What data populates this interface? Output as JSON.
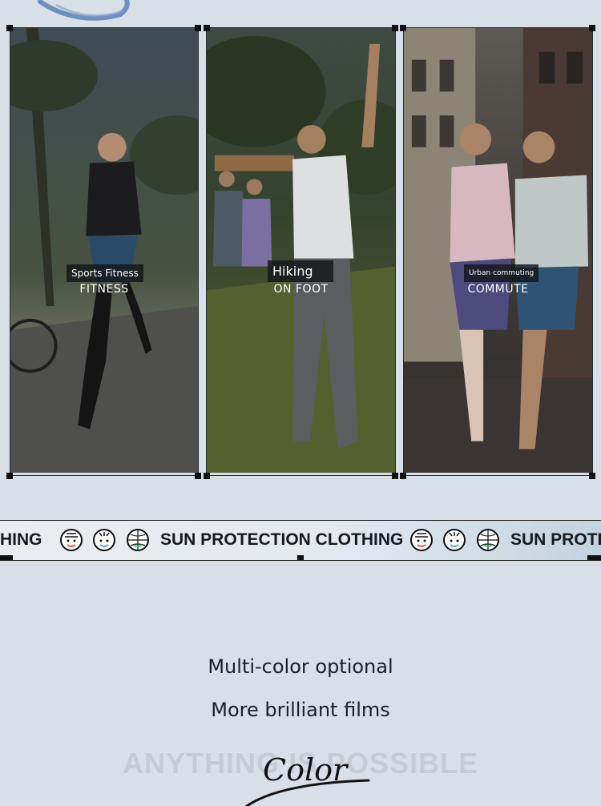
{
  "panels": [
    {
      "tag": "Sports Fitness",
      "sub": "FITNESS"
    },
    {
      "tag": "Hiking",
      "sub": "ON FOOT"
    },
    {
      "tag": "Urban commuting",
      "sub": "COMMUTE"
    }
  ],
  "marquee": {
    "partial_start": "HING",
    "text": "SUN PROTECTION CLOTHING",
    "partial_end": "SUN PROTE"
  },
  "copy": {
    "line1": "Multi-color optional",
    "line2": "More brilliant films"
  },
  "footer": {
    "ghost": "ANYTHING IS POSSIBLE",
    "script": "Color"
  },
  "icons": [
    "brush-stroke-icon",
    "face-icon",
    "smile-face-icon",
    "globe-face-icon"
  ]
}
